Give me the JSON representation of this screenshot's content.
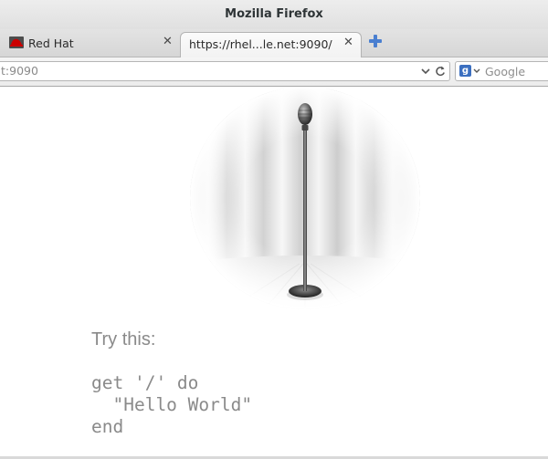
{
  "window": {
    "title": "Mozilla Firefox"
  },
  "tabs": [
    {
      "label": "Red Hat",
      "favicon": "redhat-icon",
      "close_glyph": "✕"
    },
    {
      "label": "https://rhel...le.net:9090/",
      "close_glyph": "✕"
    }
  ],
  "navbar": {
    "url": "t:9090",
    "search": {
      "engine_letter": "g",
      "placeholder": "Google"
    }
  },
  "page": {
    "illustration": "microphone-on-stage-icon",
    "try_label": "Try this:",
    "code": "get '/' do\n  \"Hello World\"\nend"
  },
  "colors": {
    "new_tab_plus": "#4a7fd0",
    "redhat_red": "#cc0000",
    "search_engine_blue": "#3b6fc0",
    "muted_text": "#8a8a8a"
  }
}
